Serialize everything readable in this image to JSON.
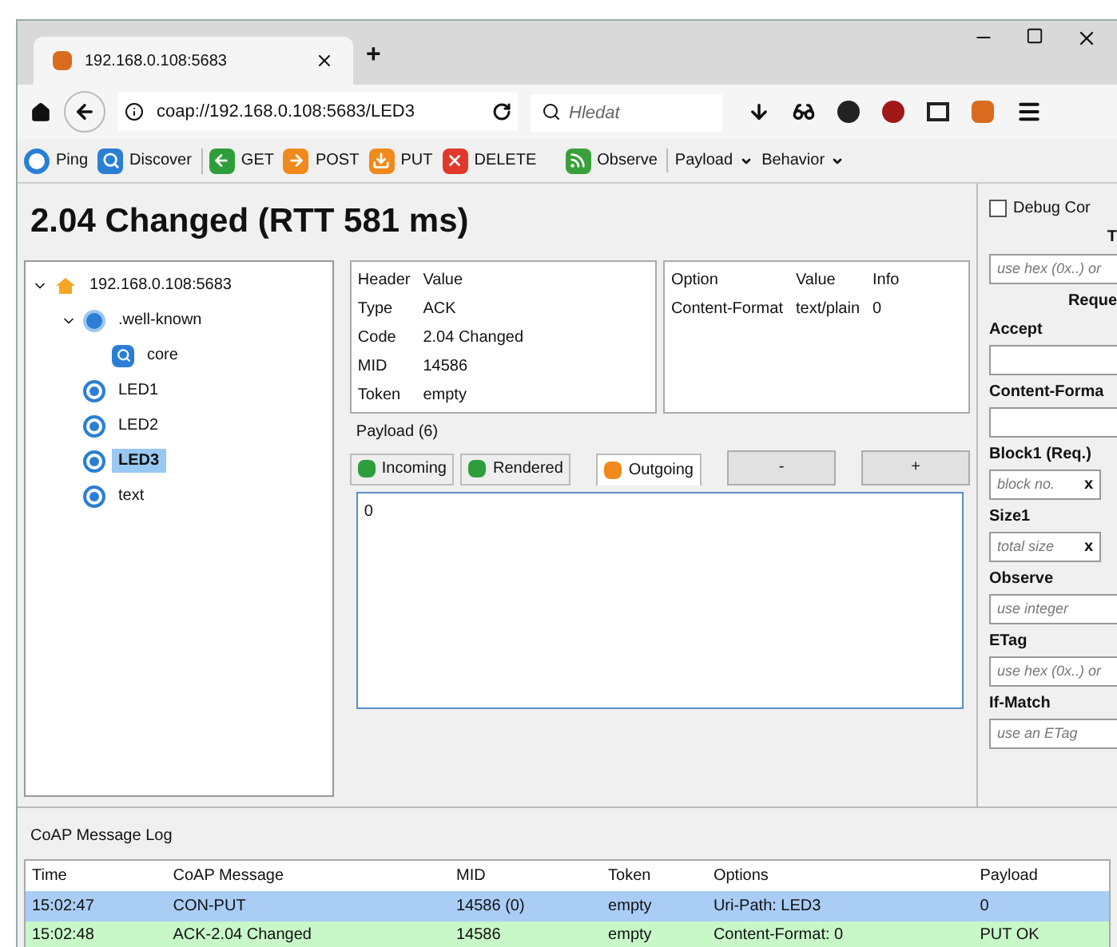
{
  "browser": {
    "tab_title": "192.168.0.108:5683",
    "new_tab": "+",
    "url": "coap://192.168.0.108:5683/LED3",
    "search": {
      "placeholder": "Hledat"
    }
  },
  "toolbar": [
    {
      "label": "Ping",
      "kind": "ping"
    },
    {
      "label": "Discover",
      "kind": "discover"
    },
    {
      "label": "GET",
      "kind": "get"
    },
    {
      "label": "POST",
      "kind": "post"
    },
    {
      "label": "PUT",
      "kind": "put"
    },
    {
      "label": "DELETE",
      "kind": "delete"
    },
    {
      "label": "Observe",
      "kind": "observe"
    },
    {
      "label": "Payload",
      "kind": "menu"
    },
    {
      "label": "Behavior",
      "kind": "menu"
    }
  ],
  "status_title": "2.04 Changed (RTT 581 ms)",
  "tree": [
    {
      "label": "192.168.0.108:5683",
      "kind": "host",
      "expanded": true,
      "selected": false,
      "children": [
        {
          "label": ".well-known",
          "kind": "folder",
          "expanded": true,
          "selected": false,
          "children": [
            {
              "label": "core",
              "kind": "core",
              "selected": false
            }
          ]
        },
        {
          "label": "LED1",
          "kind": "resource",
          "selected": false
        },
        {
          "label": "LED2",
          "kind": "resource",
          "selected": false
        },
        {
          "label": "LED3",
          "kind": "resource",
          "selected": true
        },
        {
          "label": "text",
          "kind": "resource",
          "selected": false
        }
      ]
    }
  ],
  "headers": {
    "columns": [
      "Header",
      "Value"
    ],
    "rows": [
      [
        "Type",
        "ACK"
      ],
      [
        "Code",
        "2.04 Changed"
      ],
      [
        "MID",
        "14586"
      ],
      [
        "Token",
        "empty"
      ]
    ]
  },
  "options": {
    "columns": [
      "Option",
      "Value",
      "Info"
    ],
    "rows": [
      [
        "Content-Format",
        "text/plain",
        "0"
      ]
    ]
  },
  "payload": {
    "title": "Payload (6)",
    "tabs": [
      {
        "label": "Incoming",
        "kind": "incoming",
        "selected": false
      },
      {
        "label": "Rendered",
        "kind": "rendered",
        "selected": false
      },
      {
        "label": "Outgoing",
        "kind": "outgoing",
        "selected": true
      }
    ],
    "buttons": [
      "-",
      "+"
    ],
    "value": "0"
  },
  "sidebar": {
    "debug": {
      "label": "Debug Cor",
      "checked": false
    },
    "items": [
      {
        "kind": "heading",
        "label": "T"
      },
      {
        "kind": "field",
        "placeholder": "use hex (0x..) or"
      },
      {
        "kind": "heading",
        "label": "Reque"
      },
      {
        "kind": "field",
        "label": "Accept"
      },
      {
        "kind": "field",
        "label": "Content-Forma"
      },
      {
        "kind": "clearable",
        "label": "Block1 (Req.)",
        "placeholder": "block no.",
        "clear": "x"
      },
      {
        "kind": "clearable",
        "label": "Size1",
        "placeholder": "total size",
        "clear": "x"
      },
      {
        "kind": "field",
        "label": "Observe",
        "placeholder": "use integer"
      },
      {
        "kind": "field",
        "label": "ETag",
        "placeholder": "use hex (0x..) or"
      },
      {
        "kind": "field",
        "label": "If-Match",
        "placeholder": "use an ETag"
      }
    ]
  },
  "log": {
    "title": "CoAP Message Log",
    "columns": [
      "Time",
      "CoAP Message",
      "MID",
      "Token",
      "Options",
      "Payload"
    ],
    "rows": [
      {
        "cells": [
          "15:02:47",
          "CON-PUT",
          "14586 (0)",
          "empty",
          "Uri-Path: LED3",
          "0"
        ],
        "color": "#a9cdf5"
      },
      {
        "cells": [
          "15:02:48",
          "ACK-2.04 Changed",
          "14586",
          "empty",
          "Content-Format: 0",
          "PUT OK"
        ],
        "color": "#c8f7c8"
      }
    ]
  }
}
